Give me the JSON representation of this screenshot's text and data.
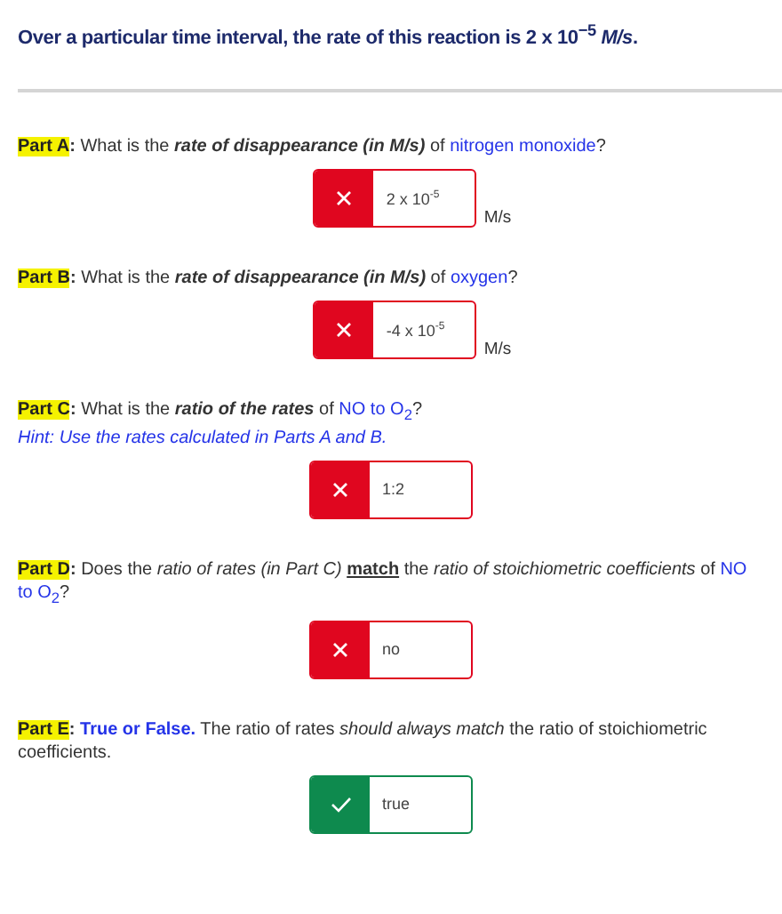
{
  "title": "Over a particular time interval, the rate of this reaction is 2 x 10$^{−5}$ *M/s*.",
  "parts": [
    {
      "label": "Part A",
      "question": [
        {
          "kind": "text",
          "text": "**:** What is the "
        },
        {
          "kind": "em",
          "text": "rate of disappearance (in M/s)"
        },
        {
          "kind": "text",
          "text": " of "
        },
        {
          "kind": "term",
          "text": "nitrogen monoxide"
        },
        {
          "kind": "text",
          "text": "?"
        }
      ],
      "answer": {
        "value": "2 x 10$^{-5}$",
        "correct": false,
        "unit": "M/s"
      }
    },
    {
      "label": "Part B",
      "question": [
        {
          "kind": "text",
          "text": "**:** What is the "
        },
        {
          "kind": "em",
          "text": "rate of disappearance (in M/s)"
        },
        {
          "kind": "text",
          "text": " of "
        },
        {
          "kind": "term",
          "text": "oxygen"
        },
        {
          "kind": "text",
          "text": "?"
        }
      ],
      "answer": {
        "value": "-4 x 10$^{-5}$",
        "correct": false,
        "unit": "M/s"
      }
    },
    {
      "label": "Part C",
      "question": [
        {
          "kind": "text",
          "text": "**:** What is the "
        },
        {
          "kind": "em",
          "text": "ratio of the rates"
        },
        {
          "kind": "text",
          "text": " of "
        },
        {
          "kind": "term",
          "text": "NO to O$_{2}$"
        },
        {
          "kind": "text",
          "text": "?"
        }
      ],
      "hint": "Hint: Use the rates calculated in Parts A and B.",
      "answer": {
        "value": "1:2",
        "correct": false
      }
    },
    {
      "label": "Part D",
      "question": [
        {
          "kind": "text",
          "text": "**:** Does the "
        },
        {
          "kind": "it",
          "text": "ratio of rates (in Part C) "
        },
        {
          "kind": "key",
          "text": "match"
        },
        {
          "kind": "text",
          "text": " the "
        },
        {
          "kind": "it",
          "text": "ratio of stoichiometric coefficients"
        },
        {
          "kind": "text",
          "text": " of "
        },
        {
          "kind": "term",
          "text": "NO to O$_{2}$"
        },
        {
          "kind": "text",
          "text": "?"
        }
      ],
      "answer": {
        "value": "no",
        "correct": false
      }
    },
    {
      "label": "Part E",
      "question": [
        {
          "kind": "text",
          "text": "**:** "
        },
        {
          "kind": "lead",
          "text": "True or False."
        },
        {
          "kind": "text",
          "text": " The ratio of rates "
        },
        {
          "kind": "it",
          "text": "should always match"
        },
        {
          "kind": "text",
          "text": " the ratio of stoichiometric coefficients."
        }
      ],
      "answer": {
        "value": "true",
        "correct": true
      }
    }
  ]
}
